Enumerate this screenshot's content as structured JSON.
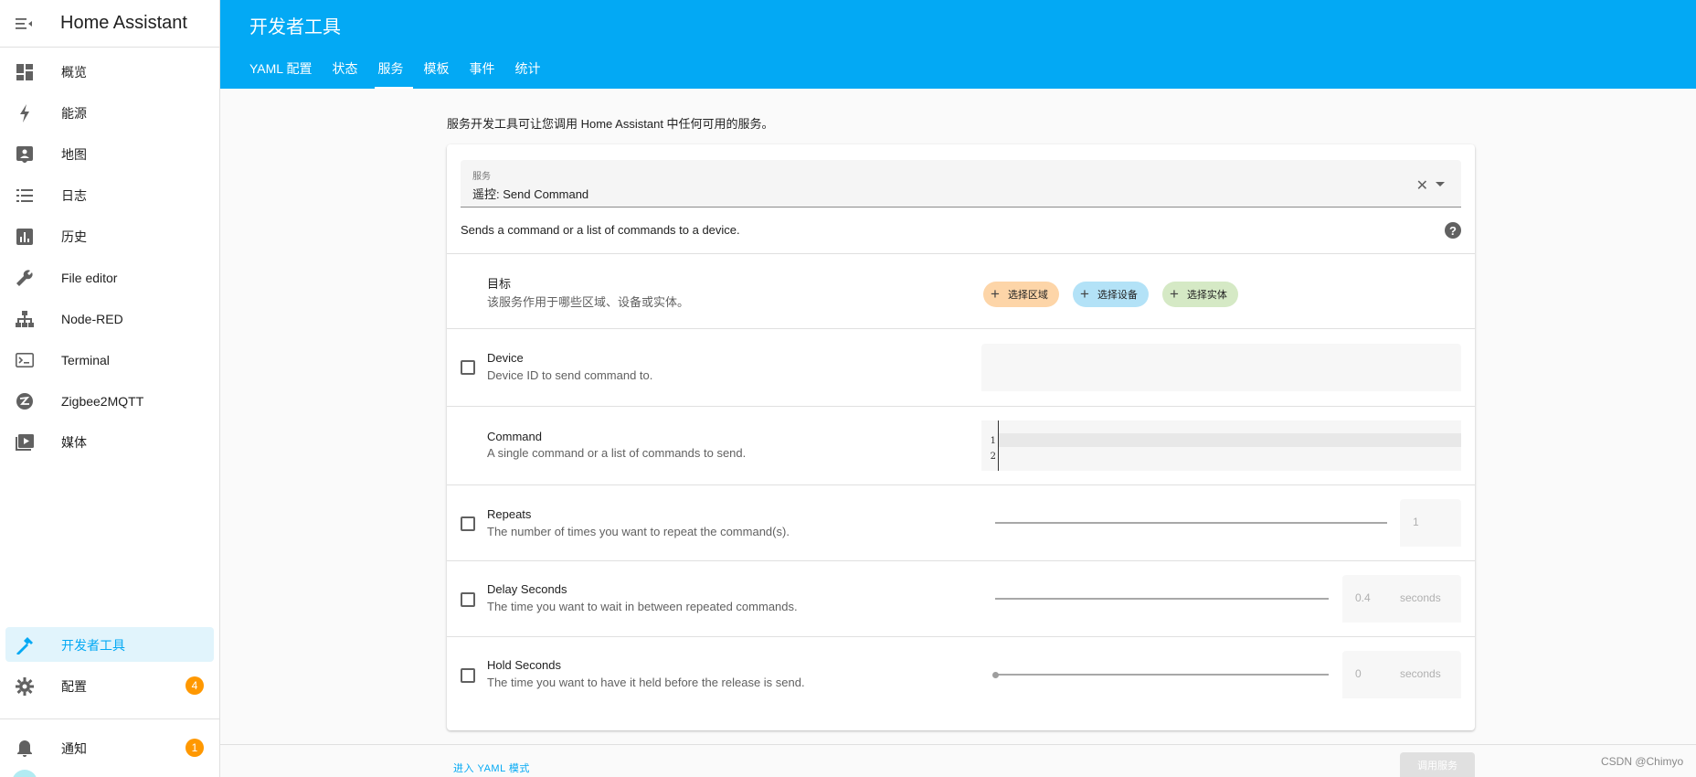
{
  "sidebar": {
    "title": "Home Assistant",
    "items": [
      {
        "label": "概览",
        "icon": "dashboard-icon"
      },
      {
        "label": "能源",
        "icon": "lightning-bolt-icon"
      },
      {
        "label": "地图",
        "icon": "map-account-icon"
      },
      {
        "label": "日志",
        "icon": "list-icon"
      },
      {
        "label": "历史",
        "icon": "chart-box-icon"
      },
      {
        "label": "File editor",
        "icon": "wrench-icon"
      },
      {
        "label": "Node-RED",
        "icon": "sitemap-icon"
      },
      {
        "label": "Terminal",
        "icon": "console-icon"
      },
      {
        "label": "Zigbee2MQTT",
        "icon": "zigbee-icon"
      },
      {
        "label": "媒体",
        "icon": "play-box-icon"
      }
    ],
    "developer_tools": "开发者工具",
    "config": "配置",
    "config_badge": "4",
    "notifications": "通知",
    "notifications_badge": "1"
  },
  "header": {
    "title": "开发者工具",
    "tabs": [
      {
        "label": "YAML 配置"
      },
      {
        "label": "状态"
      },
      {
        "label": "服务",
        "active": true
      },
      {
        "label": "模板"
      },
      {
        "label": "事件"
      },
      {
        "label": "统计"
      }
    ]
  },
  "intro": "服务开发工具可让您调用 Home Assistant 中任何可用的服务。",
  "service": {
    "label": "服务",
    "value": "遥控: Send Command",
    "description": "Sends a command or a list of commands to a device."
  },
  "target": {
    "name": "目标",
    "description": "该服务作用于哪些区域、设备或实体。",
    "chips": [
      "选择区域",
      "选择设备",
      "选择实体"
    ]
  },
  "fields": {
    "device": {
      "name": "Device",
      "description": "Device ID to send command to."
    },
    "command": {
      "name": "Command",
      "description": "A single command or a list of commands to send.",
      "lines": [
        "1",
        "2"
      ]
    },
    "repeats": {
      "name": "Repeats",
      "description": "The number of times you want to repeat the command(s).",
      "value": "1"
    },
    "delay": {
      "name": "Delay Seconds",
      "description": "The time you want to wait in between repeated commands.",
      "value": "0.4",
      "unit": "seconds"
    },
    "hold": {
      "name": "Hold Seconds",
      "description": "The time you want to have it held before the release is send.",
      "value": "0",
      "unit": "seconds"
    }
  },
  "footer": {
    "yaml_mode": "进入 YAML 模式",
    "call_service": "调用服务"
  },
  "watermark": "CSDN @Chimyo",
  "colors": {
    "primary": "#03a9f4",
    "badge": "#ff9800",
    "chip_area": "#fdd5a8",
    "chip_device": "#b3e2f7",
    "chip_entity": "#d5e9c5"
  }
}
